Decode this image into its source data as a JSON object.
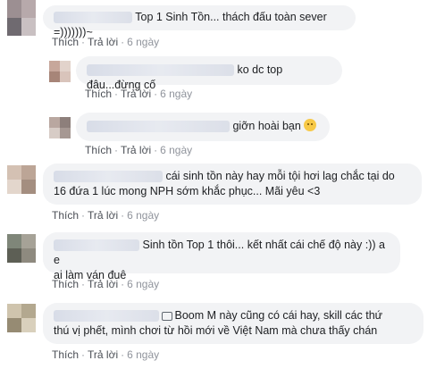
{
  "comments": [
    {
      "text": "Top 1 Sinh Tồn... thách đấu toàn sever =)))))))~",
      "actions": {
        "like": "Thích",
        "reply": "Trả lời",
        "time": "6 ngày"
      }
    },
    {
      "text": "ko dc top đâu...đừng cố",
      "actions": {
        "like": "Thích",
        "reply": "Trả lời",
        "time": "6 ngày"
      }
    },
    {
      "text": "giỡn hoài bạn",
      "emoji": "thinking-face",
      "actions": {
        "like": "Thích",
        "reply": "Trả lời",
        "time": "6 ngày"
      }
    },
    {
      "line1": "cái sinh tồn này hay mỗi tội hơi lag chắc tại do",
      "line2": "16 đứa 1 lúc mong NPH sớm khắc phục... Mãi yêu <3",
      "actions": {
        "like": "Thích",
        "reply": "Trả lời",
        "time": "6 ngày"
      }
    },
    {
      "line1": "Sinh tồn Top 1 thôi... kết nhất cái chế độ này :)) a e",
      "line2": "ai làm ván đuê",
      "actions": {
        "like": "Thích",
        "reply": "Trả lời",
        "time": "6 ngày"
      }
    },
    {
      "line1": "Boom M này cũng có cái hay, skill các thứ",
      "line2": "thú vị phết, mình chơi từ hồi mới về Việt Nam mà chưa thấy chán",
      "actions": {
        "like": "Thích",
        "reply": "Trả lời",
        "time": "6 ngày"
      }
    }
  ]
}
